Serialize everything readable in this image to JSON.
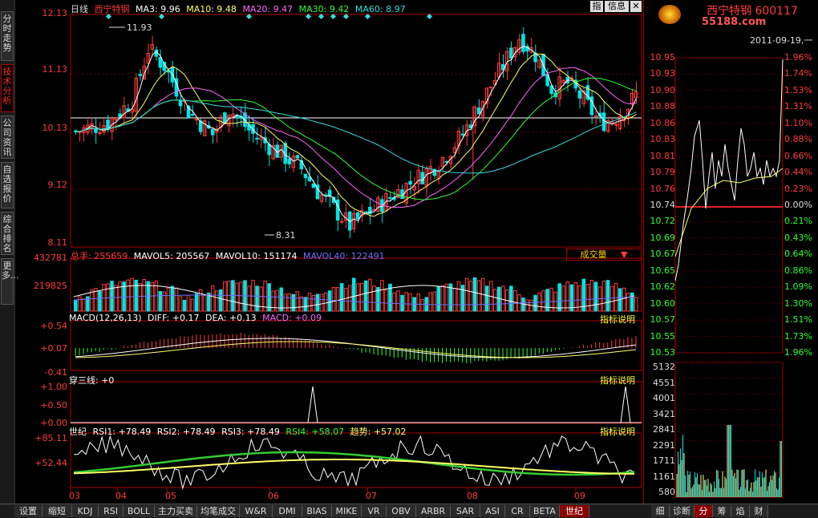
{
  "left_tabs": [
    {
      "label": "分时走势",
      "active": false
    },
    {
      "label": "技术分析",
      "active": true
    },
    {
      "label": "公司资讯",
      "active": false
    },
    {
      "label": "自选报价",
      "active": false
    },
    {
      "label": "综合排名",
      "active": false
    },
    {
      "label": "更多...",
      "active": false
    }
  ],
  "main_header": {
    "period": "日线",
    "stock": "西宁特钢",
    "ma3": "MA3: 9.96",
    "ma10": "MA10: 9.48",
    "ma20": "MA20: 9.47",
    "ma30": "MA30: 9.42",
    "ma60": "MA60: 8.97"
  },
  "top_right_buttons": {
    "zhi": "指",
    "info": "信息"
  },
  "price_axis": [
    "12.13",
    "11.13",
    "10.13",
    "9.12",
    "8.11"
  ],
  "price_annotations": {
    "high": "11.93",
    "low": "8.31"
  },
  "volume_header": {
    "total": "总手: 255659",
    "vol5": "MAVOL5: 205567",
    "vol10": "MAVOL10: 151174",
    "vol40": "MAVOL40: 122491"
  },
  "volume_dropdown": "成交量",
  "volume_axis": [
    "432781",
    "219825"
  ],
  "macd_header": {
    "name": "MACD(12,26,13)",
    "diff": "DIFF: +0.17",
    "dea": "DEA: +0.13",
    "macd": "MACD: +0.09"
  },
  "macd_axis": [
    "+0.54",
    "+0.07",
    "-0.41"
  ],
  "indicator_help": "指标说明",
  "csx_header": "穿三线: +0",
  "csx_axis": [
    "+1.00",
    "+0.50",
    "+0.00"
  ],
  "rsi_header": {
    "name": "世纪",
    "rsi1": "RSI1: +78.49",
    "rsi2": "RSI2: +78.49",
    "rsi3": "RSI3: +78.49",
    "rsi4": "RSI4: +58.07",
    "trend": "趋势: +57.02"
  },
  "rsi_axis": [
    "+85.11",
    "+52.44"
  ],
  "month_axis": [
    "03",
    "04",
    "05",
    "06",
    "07",
    "08",
    "09"
  ],
  "bottom_tabs": [
    {
      "label": "设置",
      "active": false
    },
    {
      "label": "缩短",
      "active": false
    },
    {
      "label": "KDJ",
      "active": false
    },
    {
      "label": "RSI",
      "active": false
    },
    {
      "label": "BOLL",
      "active": false
    },
    {
      "label": "主力买卖",
      "active": false
    },
    {
      "label": "均笔成交",
      "active": false
    },
    {
      "label": "W&R",
      "active": false
    },
    {
      "label": "DMI",
      "active": false
    },
    {
      "label": "BIAS",
      "active": false
    },
    {
      "label": "MIKE",
      "active": false
    },
    {
      "label": "VR",
      "active": false
    },
    {
      "label": "OBV",
      "active": false
    },
    {
      "label": "ARBR",
      "active": false
    },
    {
      "label": "SAR",
      "active": false
    },
    {
      "label": "ASI",
      "active": false
    },
    {
      "label": "CR",
      "active": false
    },
    {
      "label": "BETA",
      "active": false
    },
    {
      "label": "世纪",
      "active": true
    }
  ],
  "right_tabs": [
    {
      "label": "细",
      "active": false
    },
    {
      "label": "诊断",
      "active": false
    },
    {
      "label": "分",
      "active": true
    },
    {
      "label": "筹",
      "active": false
    },
    {
      "label": "焰",
      "active": false
    },
    {
      "label": "财",
      "active": false
    }
  ],
  "right_panel": {
    "title": "西宁特钢 600117",
    "logo": "55188.com",
    "date": "2011-09-19,一",
    "prices": [
      "10.95",
      "10.93",
      "10.90",
      "10.88",
      "10.86",
      "10.83",
      "10.81",
      "10.79",
      "10.76",
      "10.74",
      "10.72",
      "10.69",
      "10.67",
      "10.65",
      "10.62",
      "10.60",
      "10.57",
      "10.55",
      "10.53"
    ],
    "percents": [
      "1.96%",
      "1.74%",
      "1.53%",
      "1.31%",
      "1.10%",
      "0.88%",
      "0.66%",
      "0.44%",
      "0.23%",
      "0.00%",
      "0.21%",
      "0.43%",
      "0.64%",
      "0.86%",
      "1.09%",
      "1.30%",
      "1.51%",
      "1.73%",
      "1.96%"
    ],
    "volumes": [
      "5132",
      "4551",
      "4001",
      "3421",
      "2841",
      "2291",
      "1711",
      "1161",
      "580"
    ]
  },
  "colors": {
    "up": "#ff3c3c",
    "down": "#00e5e5",
    "ma3": "#ffffff",
    "ma10": "#ffff66",
    "ma20": "#ff66ff",
    "ma30": "#33ff33",
    "ma60": "#33dddd"
  }
}
